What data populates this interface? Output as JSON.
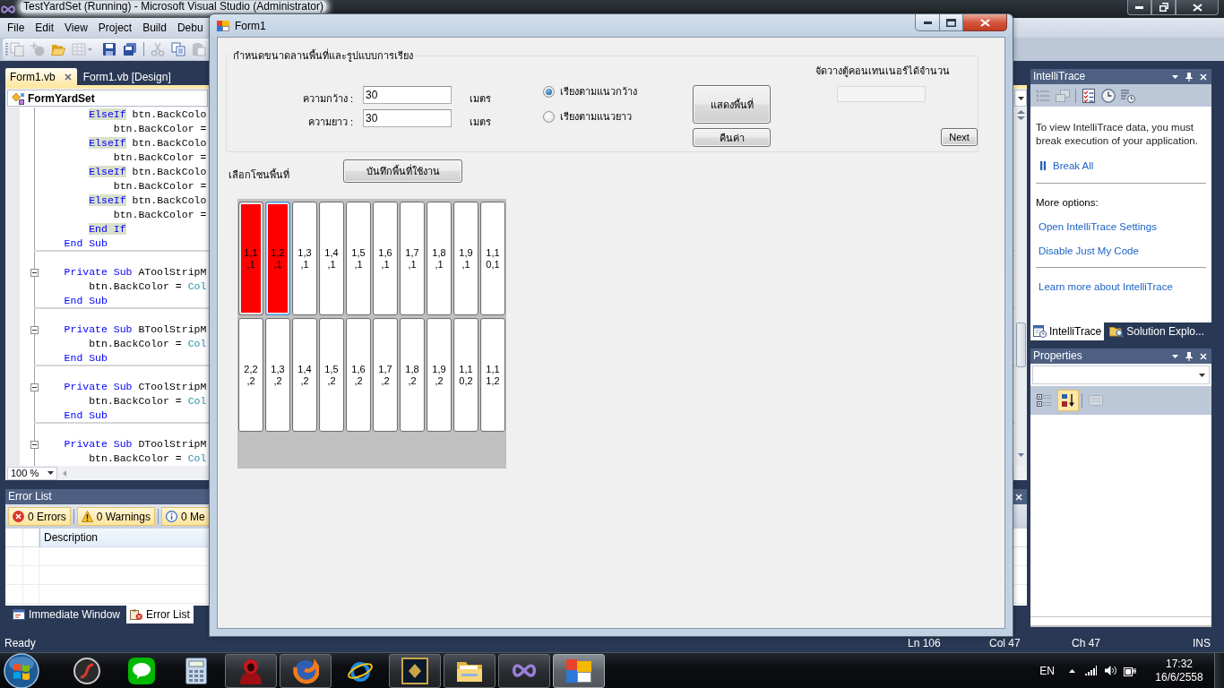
{
  "ide": {
    "title": "TestYardSet (Running) - Microsoft Visual Studio (Administrator)",
    "menu": [
      "File",
      "Edit",
      "View",
      "Project",
      "Build",
      "Debu"
    ],
    "toolbar": [
      {
        "kind": "documents",
        "disabled": true
      },
      {
        "kind": "sparkle",
        "disabled": true
      },
      {
        "kind": "folder",
        "disabled": false
      },
      {
        "kind": "grid",
        "disabled": true
      },
      {
        "kind": "disk",
        "disabled": false
      },
      {
        "kind": "disks",
        "disabled": false
      },
      {
        "kind": "scissors",
        "disabled": true
      },
      {
        "kind": "copy",
        "disabled": false
      },
      {
        "kind": "clipboard",
        "disabled": true
      }
    ],
    "document_tabs": [
      {
        "label": "Form1.vb",
        "selected": true
      },
      {
        "label": "Form1.vb [Design]",
        "selected": false
      }
    ],
    "navigation_type": "FormYardSet",
    "code_lines": [
      {
        "kind": "elseif",
        "segments": [
          {
            "text": "ElseIf",
            "kind": "keyword",
            "highlighted": true
          },
          {
            "text": " btn.BackColo",
            "kind": "plain",
            "highlighted": false
          }
        ]
      },
      {
        "kind": "assign",
        "segments": [
          {
            "text": "btn.BackColor =",
            "kind": "plain",
            "highlighted": false
          }
        ]
      },
      {
        "kind": "elseif",
        "segments": [
          {
            "text": "ElseIf",
            "kind": "keyword",
            "highlighted": true
          },
          {
            "text": " btn.BackColo",
            "kind": "plain",
            "highlighted": false
          }
        ]
      },
      {
        "kind": "assign",
        "segments": [
          {
            "text": "btn.BackColor =",
            "kind": "plain",
            "highlighted": false
          }
        ]
      },
      {
        "kind": "elseif",
        "segments": [
          {
            "text": "ElseIf",
            "kind": "keyword",
            "highlighted": true
          },
          {
            "text": " btn.BackColo",
            "kind": "plain",
            "highlighted": false
          }
        ]
      },
      {
        "kind": "assign",
        "segments": [
          {
            "text": "btn.BackColor =",
            "kind": "plain",
            "highlighted": false
          }
        ]
      },
      {
        "kind": "elseif",
        "segments": [
          {
            "text": "ElseIf",
            "kind": "keyword",
            "highlighted": true
          },
          {
            "text": " btn.BackColo",
            "kind": "plain",
            "highlighted": false
          }
        ]
      },
      {
        "kind": "assign",
        "segments": [
          {
            "text": "btn.BackColor =",
            "kind": "plain",
            "highlighted": false
          }
        ]
      },
      {
        "kind": "end-if",
        "segments": [
          {
            "text": "End If",
            "kind": "keyword",
            "highlighted": true
          }
        ]
      },
      {
        "kind": "end-sub",
        "segments": [
          {
            "text": "End Sub",
            "kind": "keyword",
            "highlighted": false
          }
        ]
      },
      {
        "kind": "blank"
      },
      {
        "kind": "sub",
        "segments": [
          {
            "text": "Private Sub",
            "kind": "keyword",
            "highlighted": false
          },
          {
            "text": " AToolStripM",
            "kind": "plain",
            "highlighted": false
          }
        ]
      },
      {
        "kind": "statement",
        "segments": [
          {
            "text": "btn.BackColor = ",
            "kind": "plain",
            "highlighted": false
          },
          {
            "text": "Col",
            "kind": "type",
            "highlighted": false
          }
        ]
      },
      {
        "kind": "end-sub",
        "segments": [
          {
            "text": "End Sub",
            "kind": "keyword",
            "highlighted": false
          }
        ]
      },
      {
        "kind": "blank"
      },
      {
        "kind": "sub",
        "segments": [
          {
            "text": "Private Sub",
            "kind": "keyword",
            "highlighted": false
          },
          {
            "text": " BToolStripM",
            "kind": "plain",
            "highlighted": false
          }
        ]
      },
      {
        "kind": "statement",
        "segments": [
          {
            "text": "btn.BackColor = ",
            "kind": "plain",
            "highlighted": false
          },
          {
            "text": "Col",
            "kind": "type",
            "highlighted": false
          }
        ]
      },
      {
        "kind": "end-sub",
        "segments": [
          {
            "text": "End Sub",
            "kind": "keyword",
            "highlighted": false
          }
        ]
      },
      {
        "kind": "blank"
      },
      {
        "kind": "sub",
        "segments": [
          {
            "text": "Private Sub",
            "kind": "keyword",
            "highlighted": false
          },
          {
            "text": " CToolStripM",
            "kind": "plain",
            "highlighted": false
          }
        ]
      },
      {
        "kind": "statement",
        "segments": [
          {
            "text": "btn.BackColor = ",
            "kind": "plain",
            "highlighted": false
          },
          {
            "text": "Col",
            "kind": "type",
            "highlighted": false
          }
        ]
      },
      {
        "kind": "end-sub",
        "segments": [
          {
            "text": "End Sub",
            "kind": "keyword",
            "highlighted": false
          }
        ]
      },
      {
        "kind": "blank"
      },
      {
        "kind": "sub",
        "segments": [
          {
            "text": "Private Sub",
            "kind": "keyword",
            "highlighted": false
          },
          {
            "text": " DToolStripM",
            "kind": "plain",
            "highlighted": false
          }
        ]
      },
      {
        "kind": "statement",
        "segments": [
          {
            "text": "btn.BackColor = ",
            "kind": "plain",
            "highlighted": false
          },
          {
            "text": "Col",
            "kind": "type",
            "highlighted": false
          }
        ]
      }
    ],
    "zoom": "100 %",
    "error_list": {
      "title": "Error List",
      "filters": [
        {
          "kind": "error",
          "label": "0 Errors",
          "selected": true
        },
        {
          "kind": "warning",
          "label": "0 Warnings",
          "selected": true
        },
        {
          "kind": "message",
          "label": "0 Me",
          "selected": true
        }
      ],
      "columns": [
        "Description"
      ]
    },
    "bottom_tabs": [
      {
        "kind": "immediate",
        "label": "Immediate Window",
        "selected": false
      },
      {
        "kind": "errors",
        "label": "Error List",
        "selected": true
      }
    ],
    "intellitrace": {
      "title": "IntelliTrace",
      "toolbar": [
        {
          "kind": "list",
          "disabled": true
        },
        {
          "kind": "windows",
          "disabled": true
        },
        {
          "kind": "checklist",
          "disabled": false
        },
        {
          "kind": "clock",
          "disabled": false
        },
        {
          "kind": "stack",
          "disabled": false
        }
      ],
      "message": "To view IntelliTrace data, you must break execution of your application.",
      "break_link": "Break All",
      "options_heading": "More options:",
      "option_links": [
        "Open IntelliTrace Settings",
        "Disable Just My Code"
      ],
      "learn_link": "Learn more about IntelliTrace"
    },
    "side_tabs": [
      {
        "kind": "intellitrace",
        "label": "IntelliTrace",
        "selected": true
      },
      {
        "kind": "solution",
        "label": "Solution Explo...",
        "selected": false
      }
    ],
    "properties": {
      "title": "Properties",
      "toolbar": [
        {
          "kind": "categorized",
          "selected": false,
          "disabled": false
        },
        {
          "kind": "alphabetical",
          "selected": true,
          "disabled": false
        },
        {
          "kind": "pages",
          "selected": false,
          "disabled": true
        }
      ]
    },
    "status_bar": {
      "message": "Ready",
      "line": "Ln 106",
      "column": "Col 47",
      "character": "Ch 47",
      "mode": "INS"
    }
  },
  "form": {
    "title": "Form1",
    "group_title": "กำหนดขนาดลานพื้นที่และรูปแบบการเรียง",
    "fields": [
      {
        "label": "ความกว้าง :",
        "value": "30",
        "unit": "เมตร"
      },
      {
        "label": "ความยาว :",
        "value": "30",
        "unit": "เมตร"
      }
    ],
    "arrangements": [
      {
        "label": "เรียงตามแนวกว้าง",
        "selected": true
      },
      {
        "label": "เรียงตามแนวยาว",
        "selected": false
      }
    ],
    "show_button": "แสดงพื้นที่",
    "reset_button": "คืนค่า",
    "capacity_label": "จัดวางตู้คอนเทนเนอร์ได้จำนวน",
    "capacity_field": {
      "disabled": true
    },
    "next_button": "Next",
    "zone_label": "เลือกโซนพื้นที่",
    "save_button": "บันทึกพื้นที่ใช้งาน",
    "slot_rows": [
      [
        {
          "label": "1,1,1",
          "selected": true,
          "focused": false
        },
        {
          "label": "1,2,1",
          "selected": true,
          "focused": true
        },
        {
          "label": "1,3,1",
          "selected": false,
          "focused": false
        },
        {
          "label": "1,4,1",
          "selected": false,
          "focused": false
        },
        {
          "label": "1,5,1",
          "selected": false,
          "focused": false
        },
        {
          "label": "1,6,1",
          "selected": false,
          "focused": false
        },
        {
          "label": "1,7,1",
          "selected": false,
          "focused": false
        },
        {
          "label": "1,8,1",
          "selected": false,
          "focused": false
        },
        {
          "label": "1,9,1",
          "selected": false,
          "focused": false
        },
        {
          "label": "1,10,1",
          "selected": false,
          "focused": false
        }
      ],
      [
        {
          "label": "2,2,2",
          "selected": false,
          "focused": false
        },
        {
          "label": "1,3,2",
          "selected": false,
          "focused": false
        },
        {
          "label": "1,4,2",
          "selected": false,
          "focused": false
        },
        {
          "label": "1,5,2",
          "selected": false,
          "focused": false
        },
        {
          "label": "1,6,2",
          "selected": false,
          "focused": false
        },
        {
          "label": "1,7,2",
          "selected": false,
          "focused": false
        },
        {
          "label": "1,8,2",
          "selected": false,
          "focused": false
        },
        {
          "label": "1,9,2",
          "selected": false,
          "focused": false
        },
        {
          "label": "1,10,2",
          "selected": false,
          "focused": false
        },
        {
          "label": "1,11,2",
          "selected": false,
          "focused": false
        }
      ]
    ]
  },
  "taskbar": {
    "apps": [
      {
        "kind": "swoosh",
        "running": false,
        "selected": false
      },
      {
        "kind": "chat",
        "running": false,
        "selected": false
      },
      {
        "kind": "calculator",
        "running": false,
        "selected": false
      },
      {
        "kind": "figure",
        "running": true,
        "selected": false
      },
      {
        "kind": "globe",
        "running": true,
        "selected": false
      },
      {
        "kind": "ring",
        "running": false,
        "selected": false
      },
      {
        "kind": "tile",
        "running": true,
        "selected": false
      },
      {
        "kind": "folder",
        "running": true,
        "selected": false
      },
      {
        "kind": "infinity",
        "running": true,
        "selected": false
      },
      {
        "kind": "squares",
        "running": true,
        "selected": true
      }
    ],
    "language": "EN",
    "time": "17:32",
    "date": "16/6/2558"
  }
}
